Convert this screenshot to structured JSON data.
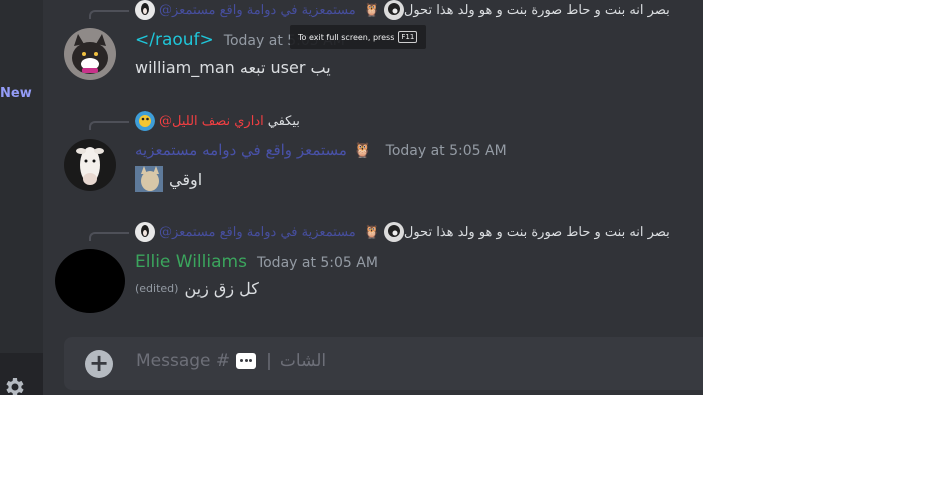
{
  "sidebar": {
    "new_label": "New"
  },
  "tooltip": {
    "text": "To exit full screen, press",
    "key": "F11"
  },
  "messages": [
    {
      "reply": {
        "mention": "@مستمعزية في دوامة واقع مستمعز",
        "owl": "🦉",
        "text": "بصر انه بنت و حاط صورة بنت و هو ولد هذا تحول"
      }
    },
    {
      "username": "</raouf>",
      "username_color": "#1fc6d9",
      "timestamp": "Today at 5:05 AM",
      "content": "william_man تبعه user يب"
    },
    {
      "reply": {
        "mention": "@اداري نصف الليل",
        "text": "بيكفي"
      },
      "username": "مستمعز واقع في دوامه مستمعزيه",
      "owl": "🦉",
      "timestamp": "Today at 5:05 AM",
      "content": "اوقي"
    },
    {
      "reply": {
        "mention": "@مستمعزية في دوامة واقع مستمعز",
        "owl": "🦉",
        "text": "بصر انه بنت و حاط صورة بنت و هو ولد هذا تحول"
      },
      "username": "Ellie Williams",
      "username_color": "#3ba55d",
      "timestamp": "Today at 5:05 AM",
      "edited": "(edited)",
      "content": "كل زق زين"
    }
  ],
  "composer": {
    "placeholder_prefix": "Message #",
    "channel": "الشات",
    "divider": "|"
  }
}
